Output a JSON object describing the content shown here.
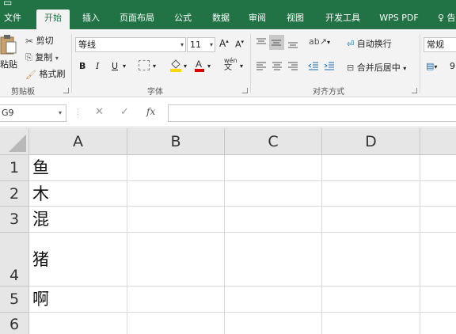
{
  "tabs": [
    {
      "label": "文件",
      "active": false
    },
    {
      "label": "开始",
      "active": true
    },
    {
      "label": "插入",
      "active": false
    },
    {
      "label": "页面布局",
      "active": false
    },
    {
      "label": "公式",
      "active": false
    },
    {
      "label": "数据",
      "active": false
    },
    {
      "label": "审阅",
      "active": false
    },
    {
      "label": "视图",
      "active": false
    },
    {
      "label": "开发工具",
      "active": false
    },
    {
      "label": "WPS PDF",
      "active": false
    }
  ],
  "help_text": "♀ 告",
  "clipboard": {
    "paste_label": "粘贴",
    "cut_label": "剪切",
    "copy_label": "复制",
    "format_painter_label": "格式刷",
    "group_label": "剪贴板"
  },
  "font": {
    "font_name": "等线",
    "font_size": "11",
    "bold": "B",
    "italic": "I",
    "underline": "U",
    "phonetic": "wén",
    "group_label": "字体"
  },
  "alignment": {
    "wrap_text_label": "自动换行",
    "merge_center_label": "合并后居中",
    "group_label": "对齐方式"
  },
  "number": {
    "format": "常规",
    "percent": "9"
  },
  "formula_bar": {
    "cell_ref": "G9",
    "fx": "fx",
    "cancel": "✕",
    "confirm": "✓",
    "value": ""
  },
  "columns": [
    "A",
    "B",
    "C",
    "D"
  ],
  "rows": [
    {
      "num": "1",
      "a": "鱼"
    },
    {
      "num": "2",
      "a": "木"
    },
    {
      "num": "3",
      "a": "混"
    },
    {
      "num": "4",
      "a": "猪"
    },
    {
      "num": "5",
      "a": "啊"
    },
    {
      "num": "6",
      "a": ""
    }
  ],
  "colors": {
    "ribbon_green": "#217346",
    "ribbon_bg": "#f3f3f3",
    "fill_yellow": "#ffd800",
    "font_red": "#e00000"
  }
}
